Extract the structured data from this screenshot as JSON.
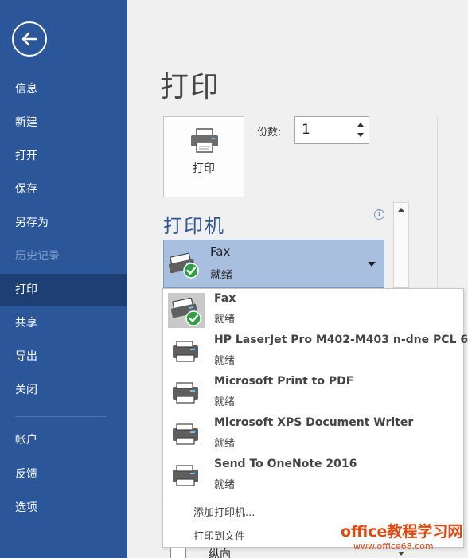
{
  "sidebar": {
    "items": [
      {
        "label": "信息",
        "state": "normal"
      },
      {
        "label": "新建",
        "state": "normal"
      },
      {
        "label": "打开",
        "state": "normal"
      },
      {
        "label": "保存",
        "state": "normal"
      },
      {
        "label": "另存为",
        "state": "normal"
      },
      {
        "label": "历史记录",
        "state": "disabled"
      },
      {
        "label": "打印",
        "state": "active"
      },
      {
        "label": "共享",
        "state": "normal"
      },
      {
        "label": "导出",
        "state": "normal"
      },
      {
        "label": "关闭",
        "state": "normal"
      },
      {
        "label": "帐户",
        "state": "normal"
      },
      {
        "label": "反馈",
        "state": "normal"
      },
      {
        "label": "选项",
        "state": "normal"
      }
    ]
  },
  "main": {
    "title": "打印",
    "print_button_label": "打印",
    "copies_label": "份数:",
    "copies_value": "1",
    "printer_heading": "打印机",
    "info_icon_glyph": "i",
    "selected_printer": {
      "name": "Fax",
      "status": "就绪"
    }
  },
  "dropdown": {
    "printers": [
      {
        "name": "Fax",
        "status": "就绪",
        "icon": "fax-icon"
      },
      {
        "name": "HP LaserJet Pro M402-M403 n-dne PCL 6",
        "status": "就绪",
        "icon": "printer-icon"
      },
      {
        "name": "Microsoft Print to PDF",
        "status": "就绪",
        "icon": "printer-icon"
      },
      {
        "name": "Microsoft XPS Document Writer",
        "status": "就绪",
        "icon": "printer-icon"
      },
      {
        "name": "Send To OneNote 2016",
        "status": "就绪",
        "icon": "printer-icon"
      }
    ],
    "add_printer": "添加打印机...",
    "print_to_file": "打印到文件"
  },
  "peek": {
    "orientation": "纵向"
  },
  "watermark": {
    "line1": "office教程学习网",
    "line2": "www.office68.com"
  },
  "colors": {
    "sidebar_bg": "#2b579a",
    "sidebar_active": "#1d3f74",
    "heading_blue": "#2b579a",
    "selected_bg": "#a9bfe0",
    "check_green": "#2f9e44"
  }
}
